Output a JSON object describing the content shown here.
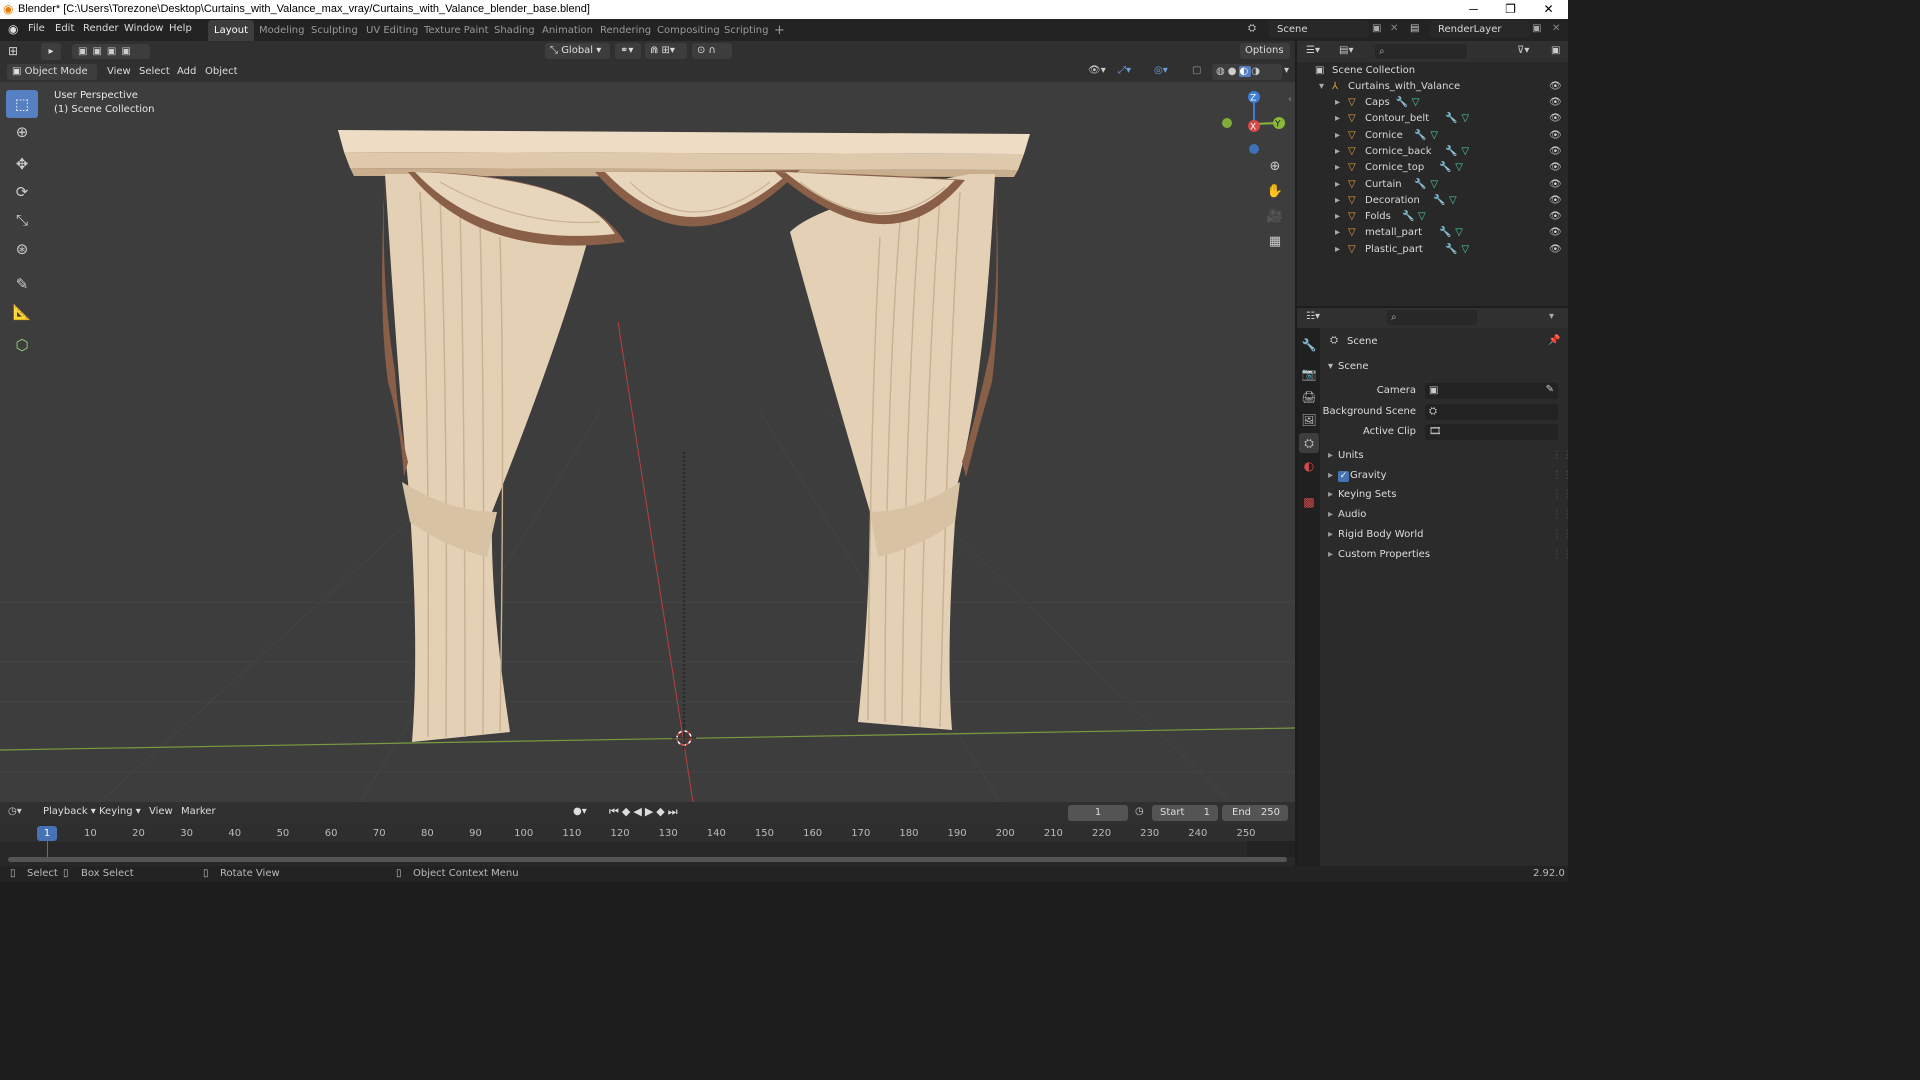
{
  "titlebar": {
    "title": "Blender* [C:\\Users\\Torezone\\Desktop\\Curtains_with_Valance_max_vray/Curtains_with_Valance_blender_base.blend]",
    "minimize": "─",
    "maximize": "❐",
    "close": "✕"
  },
  "menubar": {
    "menus": [
      "File",
      "Edit",
      "Render",
      "Window",
      "Help"
    ],
    "workspaces": [
      "Layout",
      "Modeling",
      "Sculpting",
      "UV Editing",
      "Texture Paint",
      "Shading",
      "Animation",
      "Rendering",
      "Compositing",
      "Scripting"
    ],
    "add_workspace": "+",
    "scene": "Scene",
    "view_layer": "RenderLayer"
  },
  "viewport_header": {
    "transform_orientation": "Global",
    "options": "Options",
    "mode": "Object Mode",
    "menus": [
      "View",
      "Select",
      "Add",
      "Object"
    ]
  },
  "viewport": {
    "perspective": "User Perspective",
    "collection": "(1) Scene Collection",
    "gizmo": {
      "z": "Z",
      "y": "Y",
      "x": "X"
    }
  },
  "timeline": {
    "menus": [
      "Playback",
      "Keying",
      "View",
      "Marker"
    ],
    "current_frame": "1",
    "start_label": "Start",
    "start": "1",
    "end_label": "End",
    "end": "250",
    "ticks": [
      "1",
      "10",
      "20",
      "30",
      "40",
      "50",
      "60",
      "70",
      "80",
      "90",
      "100",
      "110",
      "120",
      "130",
      "140",
      "150",
      "160",
      "170",
      "180",
      "190",
      "200",
      "210",
      "220",
      "230",
      "240",
      "250"
    ]
  },
  "statusbar": {
    "select": "Select",
    "box_select": "Box Select",
    "rotate_view": "Rotate View",
    "context_menu": "Object Context Menu",
    "version": "2.92.0"
  },
  "outliner": {
    "root": "Scene Collection",
    "collection": "Curtains_with_Valance",
    "objects": [
      "Caps",
      "Contour_belt",
      "Cornice",
      "Cornice_back",
      "Cornice_top",
      "Curtain",
      "Decoration",
      "Folds",
      "metall_part",
      "Plastic_part"
    ]
  },
  "properties": {
    "context": "Scene",
    "panel": "Scene",
    "camera_label": "Camera",
    "background_scene_label": "Background Scene",
    "active_clip_label": "Active Clip",
    "sections": [
      "Units",
      "Gravity",
      "Keying Sets",
      "Audio",
      "Rigid Body World",
      "Custom Properties"
    ],
    "gravity_checked": true
  },
  "colors": {
    "accent": "#5680c2",
    "curtain": "#e3cfb4",
    "trim": "#8a5f48",
    "x_axis": "#d44a4a",
    "y_axis": "#8ab838",
    "z_axis": "#3f7ed8"
  }
}
